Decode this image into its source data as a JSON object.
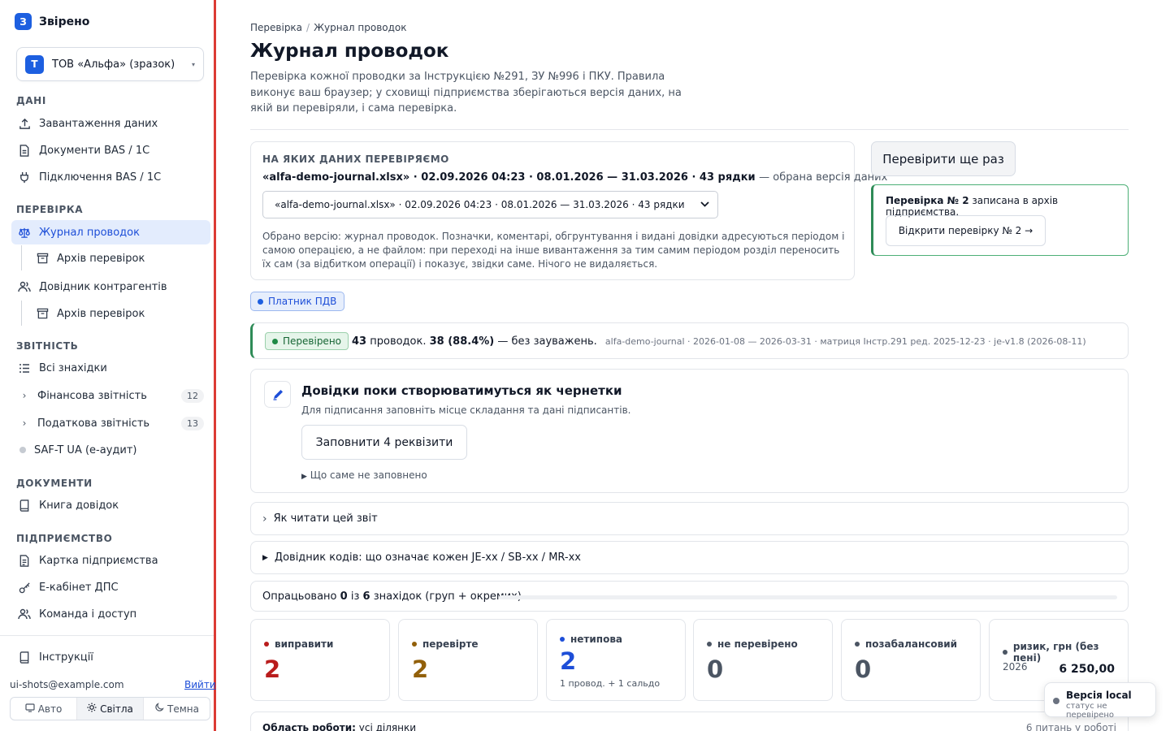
{
  "app": {
    "logo_letter": "З",
    "name": "Звірено"
  },
  "org": {
    "avatar": "Т",
    "name": "ТОВ «Альфа» (зразок)"
  },
  "sidebar": {
    "sections": {
      "data": "ДАНІ",
      "check": "ПЕРЕВІРКА",
      "reports": "ЗВІТНІСТЬ",
      "docs": "ДОКУМЕНТИ",
      "company": "ПІДПРИЄМСТВО"
    },
    "items": {
      "upload": "Завантаження даних",
      "bas_docs": "Документи BAS / 1С",
      "bas_conn": "Підключення BAS / 1С",
      "journal": "Журнал проводок",
      "archive1": "Архів перевірок",
      "contractors": "Довідник контрагентів",
      "archive2": "Архів перевірок",
      "all_findings": "Всі знахідки",
      "fin_reports": "Фінансова звітність",
      "fin_count": "12",
      "tax_reports": "Податкова звітність",
      "tax_count": "13",
      "saft": "SAF-T UA (е-аудит)",
      "book": "Книга довідок",
      "company_card": "Картка підприємства",
      "ecabinet": "Е-кабінет ДПС",
      "team": "Команда і доступ",
      "instructions": "Інструкції"
    },
    "email": "ui-shots@example.com",
    "logout": "Вийти",
    "theme": {
      "auto": "Авто",
      "light": "Світла",
      "dark": "Темна"
    }
  },
  "page": {
    "crumb_1": "Перевірка",
    "crumb_sep": "/",
    "crumb_2": "Журнал проводок",
    "title": "Журнал проводок",
    "description": "Перевірка кожної проводки за Інструкцією №291, ЗУ №996 і ПКУ. Правила виконує ваш браузер; у сховищі підприємства зберігаються версія даних, на якій ви перевіряли, і сама перевірка."
  },
  "data_card": {
    "heading": "НА ЯКИХ ДАНИХ ПЕРЕВІРЯЄМО",
    "selected_bold": "«alfa-demo-journal.xlsx» · 02.09.2026 04:23 · 08.01.2026 — 31.03.2026 · 43 рядки",
    "selected_note": "— обрана версія даних",
    "select_value": "«alfa-demo-journal.xlsx» · 02.09.2026 04:23 · 08.01.2026 — 31.03.2026 · 43 рядки",
    "note": "Обрано версію: журнал проводок. Позначки, коментарі, обгрунтування і видані довідки адресуються періодом і самою операцією, а не файлом: при переході на інше вивантаження за тим самим періодом розділ переносить їх сам (за відбитком операції) і показує, звідки саме. Нічого не видаляється."
  },
  "actions": {
    "recheck": "Перевірити ще раз",
    "archive_bold": "Перевірка № 2",
    "archive_text": "записана в архів підприємства.",
    "open_check": "Відкрити перевірку № 2 →"
  },
  "vat_badge": "Платник ПДВ",
  "status": {
    "badge": "Перевірено",
    "count": "43",
    "count_label": "проводок.",
    "ok": "38 (88.4%)",
    "ok_label": "— без зауважень.",
    "meta": "alfa-demo-journal · 2026-01-08 — 2026-03-31 · матриця Інстр.291 ред. 2025-12-23 · je-v1.8 (2026-08-11)"
  },
  "draft": {
    "title": "Довідки поки створюватимуться як чернетки",
    "subtitle": "Для підписання заповніть місце складання та дані підписантів.",
    "button": "Заповнити 4 реквізити",
    "details": "Що саме не заповнено"
  },
  "accordions": {
    "how_to_read": "Як читати цей звіт",
    "codes": "Довідник кодів: що означає кожен JE-xx / SB-xx / MR-xx"
  },
  "progress": {
    "label_1": "Опрацьовано",
    "done": "0",
    "label_2": "із",
    "total": "6",
    "label_3": "знахідок (груп + окремих)",
    "fraction": 0
  },
  "stats": {
    "fix": {
      "label": "виправити",
      "value": "2",
      "color": "#b91c1c"
    },
    "check": {
      "label": "перевірте",
      "value": "2",
      "color": "#92600a"
    },
    "atypical": {
      "label": "нетипова",
      "value": "2",
      "sub": "1 провод. + 1 сальдо",
      "color": "#1d4ed8"
    },
    "unchecked": {
      "label": "не перевірено",
      "value": "0",
      "color": "#4b5563"
    },
    "offbalance": {
      "label": "позабалансовий",
      "value": "0",
      "color": "#4b5563"
    },
    "risk": {
      "label": "ризик, грн (без пені)",
      "year": "2026",
      "value": "6 250,00"
    }
  },
  "bottom": {
    "label": "Область роботи:",
    "value": "усі ділянки",
    "right": "6 питань у роботі"
  },
  "toast": {
    "title": "Версія local",
    "subtitle": "статус не перевірено"
  }
}
